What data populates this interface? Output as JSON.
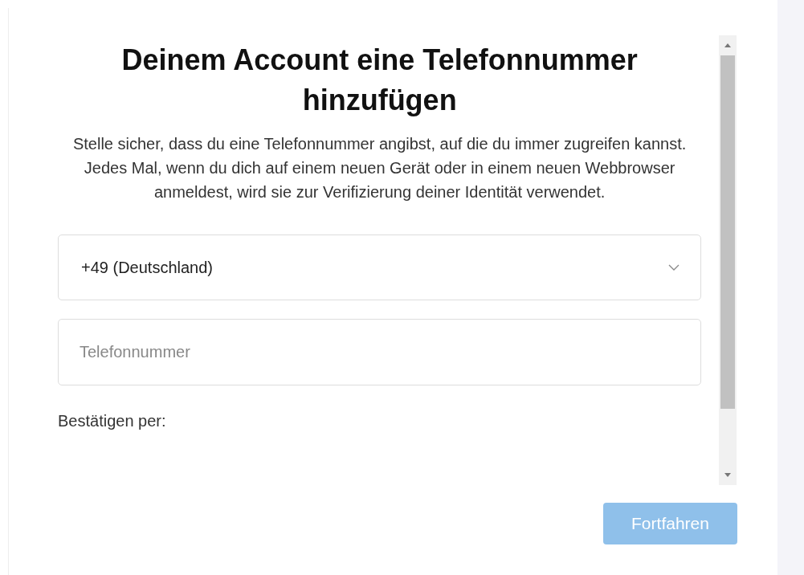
{
  "dialog": {
    "title": "Deinem Account eine Telefonnummer hinzufügen",
    "description": "Stelle sicher, dass du eine Telefonnummer angibst, auf die du immer zugreifen kannst. Jedes Mal, wenn du dich auf einem neuen Gerät oder in einem neuen Webbrowser anmeldest, wird sie zur Verifizierung deiner Identität verwendet.",
    "country_select": {
      "value": "+49 (Deutschland)"
    },
    "phone_field": {
      "placeholder": "Telefonnummer"
    },
    "confirm_label": "Bestätigen per:",
    "continue_button": {
      "label": "Fortfahren",
      "disabled": true
    }
  }
}
